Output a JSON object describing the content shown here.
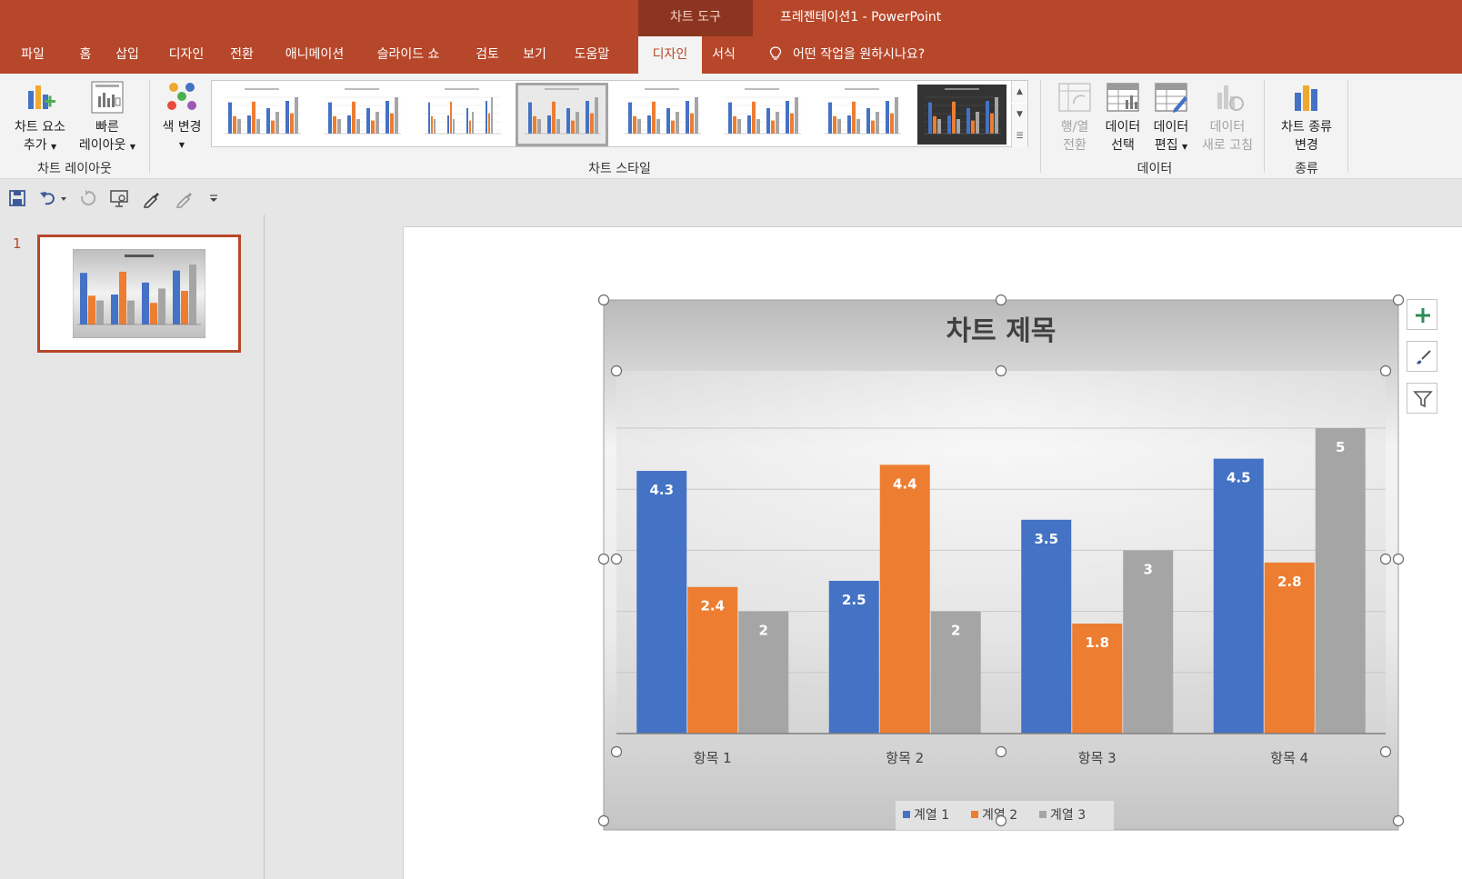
{
  "window": {
    "context_tab": "차트 도구",
    "doc_title": "프레젠테이션1  -  PowerPoint"
  },
  "tabs": [
    {
      "label": "파일"
    },
    {
      "label": "홈"
    },
    {
      "label": "삽입"
    },
    {
      "label": "디자인"
    },
    {
      "label": "전환"
    },
    {
      "label": "애니메이션"
    },
    {
      "label": "슬라이드 쇼"
    },
    {
      "label": "검토"
    },
    {
      "label": "보기"
    },
    {
      "label": "도움말"
    },
    {
      "label": "디자인"
    },
    {
      "label": "서식"
    }
  ],
  "active_tab_index": 10,
  "tellme": "어떤 작업을 원하시나요?",
  "ribbon": {
    "add_element": {
      "line1": "차트 요소",
      "line2": "추가"
    },
    "quick_layout": {
      "line1": "빠른",
      "line2": "레이아웃"
    },
    "group_layout": "차트 레이아웃",
    "change_colors": {
      "line1": "색 변경"
    },
    "group_styles": "차트 스타일",
    "switch_row_col": {
      "line1": "행/열",
      "line2": "전환"
    },
    "select_data": {
      "line1": "데이터",
      "line2": "선택"
    },
    "edit_data": {
      "line1": "데이터",
      "line2": "편집"
    },
    "refresh_data": {
      "line1": "데이터",
      "line2": "새로 고침"
    },
    "group_data": "데이터",
    "change_type": {
      "line1": "차트 종류",
      "line2": "변경"
    },
    "group_type": "종류"
  },
  "slides": {
    "current_number": "1"
  },
  "colors": {
    "accent": "#b7472a",
    "series1": "#4472c4",
    "series2": "#ed7d31",
    "series3": "#a5a5a5"
  },
  "chart_data": {
    "type": "bar",
    "title": "차트 제목",
    "categories": [
      "항목 1",
      "항목 2",
      "항목 3",
      "항목 4"
    ],
    "series": [
      {
        "name": "계열 1",
        "values": [
          4.3,
          2.5,
          3.5,
          4.5
        ]
      },
      {
        "name": "계열 2",
        "values": [
          2.4,
          4.4,
          1.8,
          2.8
        ]
      },
      {
        "name": "계열 3",
        "values": [
          2,
          2,
          3,
          5
        ]
      }
    ],
    "ylim": [
      0,
      5
    ],
    "grid": true,
    "legend": "bottom",
    "data_labels": true
  }
}
